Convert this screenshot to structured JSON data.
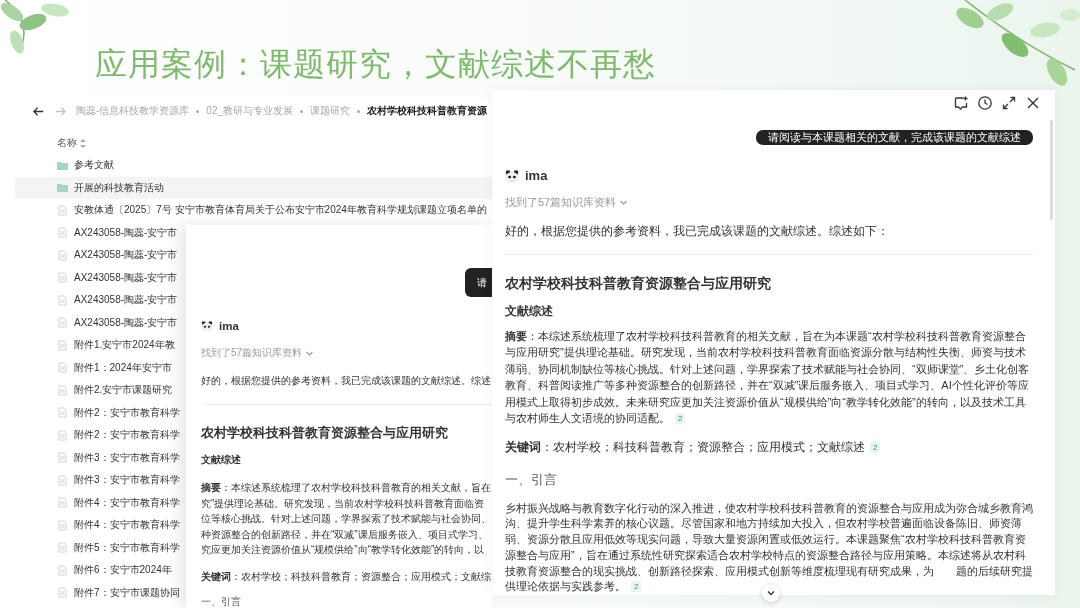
{
  "slide": {
    "title": "应用案例：课题研究，文献综述不再愁"
  },
  "file_browser": {
    "nav": [
      {
        "kind": "back",
        "disabled": false
      },
      {
        "kind": "forward",
        "disabled": true
      }
    ],
    "breadcrumb": [
      {
        "label": "陶蕊-信息科技教学资源库",
        "current": false
      },
      {
        "label": "02_教研与专业发展",
        "current": false
      },
      {
        "label": "课题研究",
        "current": false
      },
      {
        "label": "农村学校科技科普教育资源",
        "current": true
      }
    ],
    "column_header": "名称",
    "rows": [
      {
        "kind": "folder",
        "name": "参考文献",
        "highlighted": false
      },
      {
        "kind": "folder",
        "name": "开展的科技教育活动",
        "highlighted": true
      },
      {
        "kind": "file",
        "name": "安教体通〔2025〕7号 安宁市教育体育局关于公布安宁市2024年教育科学规划课题立项名单的",
        "highlighted": false
      },
      {
        "kind": "file",
        "name": "AX243058-陶蕊-安宁市",
        "highlighted": false
      },
      {
        "kind": "file",
        "name": "AX243058-陶蕊-安宁市",
        "highlighted": false
      },
      {
        "kind": "file",
        "name": "AX243058-陶蕊-安宁市",
        "highlighted": false
      },
      {
        "kind": "file",
        "name": "AX243058-陶蕊-安宁市",
        "highlighted": false
      },
      {
        "kind": "file",
        "name": "AX243058-陶蕊-安宁市",
        "highlighted": false
      },
      {
        "kind": "file",
        "name": "附件1.安宁市2024年教",
        "highlighted": false
      },
      {
        "kind": "file",
        "name": "附件1：2024年安宁市",
        "highlighted": false
      },
      {
        "kind": "file",
        "name": "附件2.安宁市课题研究",
        "highlighted": false
      },
      {
        "kind": "file",
        "name": "附件2：安宁市教育科学",
        "highlighted": false
      },
      {
        "kind": "file",
        "name": "附件2：安宁市教育科学",
        "highlighted": false
      },
      {
        "kind": "file",
        "name": "附件3：安宁市教育科学",
        "highlighted": false
      },
      {
        "kind": "file",
        "name": "附件3：安宁市教育科学",
        "highlighted": false
      },
      {
        "kind": "file",
        "name": "附件4：安宁市教育科学",
        "highlighted": false
      },
      {
        "kind": "file",
        "name": "附件4：安宁市教育科学",
        "highlighted": false
      },
      {
        "kind": "file",
        "name": "附件5：安宁市教育科学",
        "highlighted": false
      },
      {
        "kind": "file",
        "name": "附件6：安宁市2024年",
        "highlighted": false
      },
      {
        "kind": "file",
        "name": "附件7：安宁市课题协同",
        "highlighted": false
      }
    ]
  },
  "chat_behind": {
    "user_message": "请",
    "assistant": "ima",
    "sources": "找到了57篇知识库资料",
    "intro": "好的，根据您提供的参考资料，我已完成该课题的文献综述。综述",
    "heading": "农村学校科技科普教育资源整合与应用研究",
    "subheading": "文献综述",
    "abstract_lines": [
      "**摘要**：本综述系统梳理了农村学校科技科普教育的相关文献，旨在",
      "究”提供理论基础。研究发现，当前农村学校科技科普教育面临资",
      "位等核心挑战。针对上述问题，学界探索了技术赋能与社会协同、",
      "种资源整合的创新路径，并在“双减”课后服务嵌入、项目式学习、",
      "究应更加关注资源价值从“规模供给”向“教学转化效能”的转向，以"
    ],
    "keywords": "**关键词**：农村学校；科技科普教育；资源整合；应用模式；文献综",
    "section": "一、引言"
  },
  "chat_front": {
    "user_message": "请阅读与本课题相关的文献，完成该课题的文献综述",
    "assistant": "ima",
    "sources": "找到了57篇知识库资料",
    "intro": "好的，根据您提供的参考资料，我已完成该课题的文献综述。综述如下：",
    "heading": "农村学校科技科普教育资源整合与应用研究",
    "subheading": "文献综述",
    "abstract": "**摘要**：本综述系统梳理了农村学校科技科普教育的相关文献，旨在为本课题“农村学校科技科普教育资源整合与应用研究”提供理论基础。研究发现，当前农村学校科技科普教育面临资源分散与结构性失衡、师资与技术薄弱、协同机制缺位等核心挑战。针对上述问题，学界探索了技术赋能与社会协同、“双师课堂”、乡土化创客教育、科普阅读推广等多种资源整合的创新路径，并在“双减”课后服务嵌入、项目式学习、AI个性化评价等应用模式上取得初步成效。未来研究应更加关注资源价值从“规模供给”向“教学转化效能”的转向，以及技术工具与农村师生人文语境的协同适配。",
    "abstract_citation": "2",
    "keywords": "**关键词**：农村学校；科技科普教育；资源整合；应用模式；文献综述",
    "keywords_citation": "2",
    "section": "一、引言",
    "paragraph": "乡村振兴战略与教育数字化行动的深入推进，使农村学校科技科普教育的资源整合与应用成为弥合城乡教育鸿沟、提升学生科学素养的核心议题。尽管国家和地方持续加大投入，但农村学校普遍面临设备陈旧、师资薄弱、资源分散且应用低效等现实问题，导致大量资源闲置或低效运行。本课题聚焦“农村学校科技科普教育资源整合与应用”，旨在通过系统性研究探索适合农村学校特点的资源整合路径与应用策略。本综述将从农村科技教育资源整合的现实挑战、创新路径探索、应用模式创新等维度梳理现有研究成果，为　　题的后续研究提供理论依据与实践参考。",
    "paragraph_citation": "2"
  }
}
